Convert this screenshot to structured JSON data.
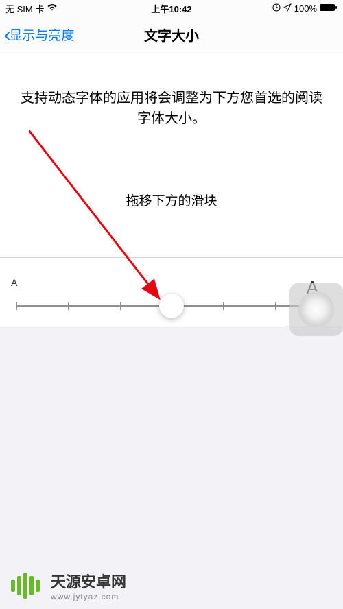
{
  "statusBar": {
    "carrier": "无 SIM 卡",
    "time": "上午10:42",
    "battery": "100%"
  },
  "navBar": {
    "backLabel": "显示与亮度",
    "title": "文字大小"
  },
  "content": {
    "description": "支持动态字体的应用将会调整为下方您首选的阅读字体大小。",
    "instruction": "拖移下方的滑块"
  },
  "slider": {
    "smallLabel": "A",
    "largeLabel": "A",
    "ticks": 7,
    "thumbPosition": 50
  },
  "watermark": {
    "title": "天源安卓网",
    "url": "www.jytyaz.com"
  }
}
